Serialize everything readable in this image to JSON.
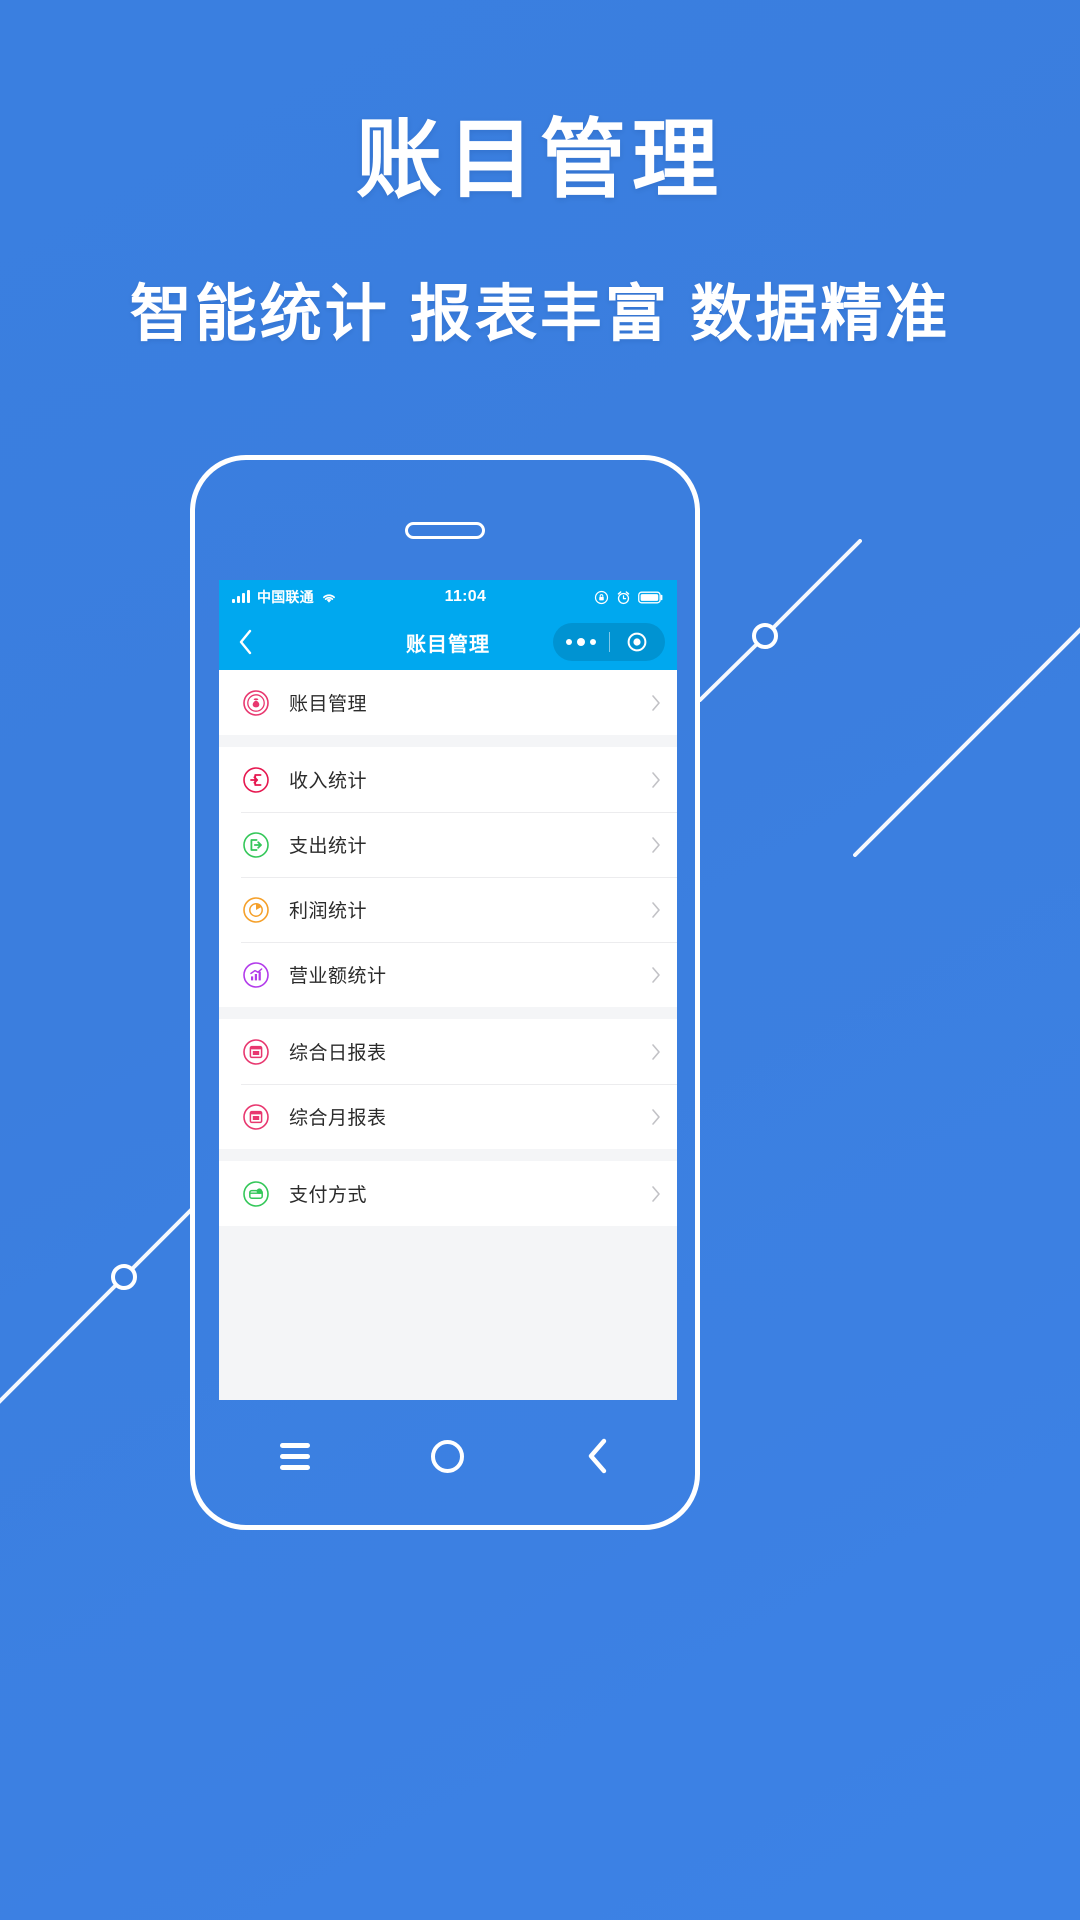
{
  "hero": {
    "title": "账目管理",
    "subtitle": "智能统计 报表丰富 数据精准"
  },
  "theme": {
    "background_blue": "#3b7ede",
    "status_bar_blue": "#00a8ef",
    "nav_bar_blue": "#00a8ef",
    "list_bg": "#f4f5f7",
    "label_color": "#2b2b2b"
  },
  "phone": {
    "status_bar": {
      "carrier": "中国联通",
      "time": "11:04",
      "signal_icon": "signal-bars-icon",
      "wifi_icon": "wifi-icon",
      "rotation_lock_icon": "rotation-lock-icon",
      "alarm_icon": "alarm-clock-icon",
      "battery_icon": "battery-icon"
    },
    "nav_bar": {
      "back_icon": "chevron-left-icon",
      "title": "账目管理",
      "capsule": {
        "more_icon": "more-dots-icon",
        "target_icon": "target-circle-icon"
      }
    },
    "list_groups": [
      {
        "items": [
          {
            "label": "账目管理",
            "icon": "money-bag-icon",
            "color": "#e8376f",
            "arrow": "chevron-right-icon"
          }
        ]
      },
      {
        "items": [
          {
            "label": "收入统计",
            "icon": "income-arrow-in-icon",
            "color": "#e6174f",
            "arrow": "chevron-right-icon"
          },
          {
            "label": "支出统计",
            "icon": "expense-arrow-out-icon",
            "color": "#34c759",
            "arrow": "chevron-right-icon"
          },
          {
            "label": "利润统计",
            "icon": "pie-chart-icon",
            "color": "#f5a02a",
            "arrow": "chevron-right-icon"
          },
          {
            "label": "营业额统计",
            "icon": "bar-chart-trend-icon",
            "color": "#b23bea",
            "arrow": "chevron-right-icon"
          }
        ]
      },
      {
        "items": [
          {
            "label": "综合日报表",
            "icon": "daily-report-icon",
            "color": "#e8376f",
            "arrow": "chevron-right-icon"
          },
          {
            "label": "综合月报表",
            "icon": "monthly-report-icon",
            "color": "#e8376f",
            "arrow": "chevron-right-icon"
          }
        ]
      },
      {
        "items": [
          {
            "label": "支付方式",
            "icon": "payment-method-icon",
            "color": "#34c759",
            "arrow": "chevron-right-icon"
          }
        ]
      }
    ],
    "android_nav": {
      "menu_icon": "menu-hamburger-icon",
      "home_icon": "home-circle-icon",
      "back_icon": "nav-back-chevron-icon"
    }
  }
}
